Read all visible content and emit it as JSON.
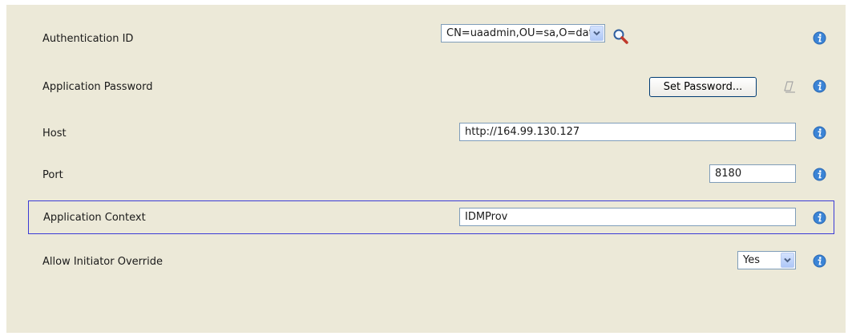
{
  "fields": {
    "authentication_id": {
      "label": "Authentication ID",
      "value": "CN=uaadmin,OU=sa,O=data"
    },
    "application_password": {
      "label": "Application Password",
      "button_label": "Set Password..."
    },
    "host": {
      "label": "Host",
      "value": "http://164.99.130.127"
    },
    "port": {
      "label": "Port",
      "value": "8180"
    },
    "application_context": {
      "label": "Application Context",
      "value": "IDMProv"
    },
    "allow_initiator_override": {
      "label": "Allow Initiator Override",
      "selected": "Yes"
    }
  },
  "icons": {
    "info": "info-icon",
    "search": "magnifier-search-icon",
    "clear": "eraser-clear-password-icon",
    "dropdown": "chevron-down-icon"
  },
  "colors": {
    "panel_bg": "#ece9d8",
    "focus_border": "#3a3ad6",
    "input_border": "#7f9db9",
    "info_blue": "#3b84d6"
  }
}
